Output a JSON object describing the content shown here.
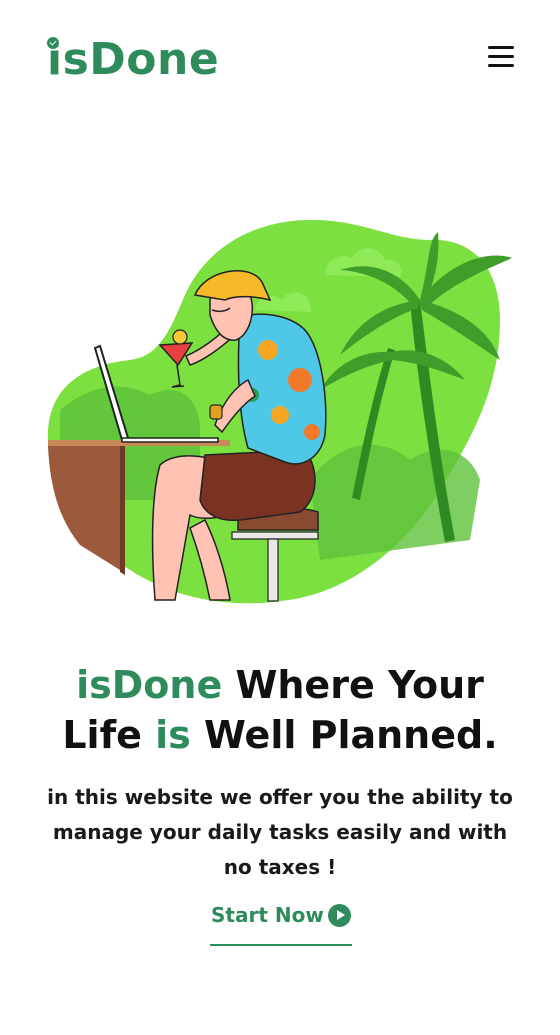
{
  "header": {
    "logo_text": "isDone",
    "menu_icon": "hamburger-menu-icon"
  },
  "hero": {
    "illustration": "man-working-on-laptop-at-beach-bar-illustration",
    "headline_part1": "isDone",
    "headline_part2": " Where Your",
    "headline_part3": "Life ",
    "headline_part4": "is",
    "headline_part5": " Well Planned.",
    "description": "in this website we offer you the ability to manage your daily tasks easily and with no taxes !",
    "cta_label": "Start Now",
    "cta_icon": "play-circle-icon"
  },
  "colors": {
    "brand": "#2e8b5b",
    "text": "#111111",
    "background": "#ffffff",
    "illustration_green": "#7be040"
  }
}
